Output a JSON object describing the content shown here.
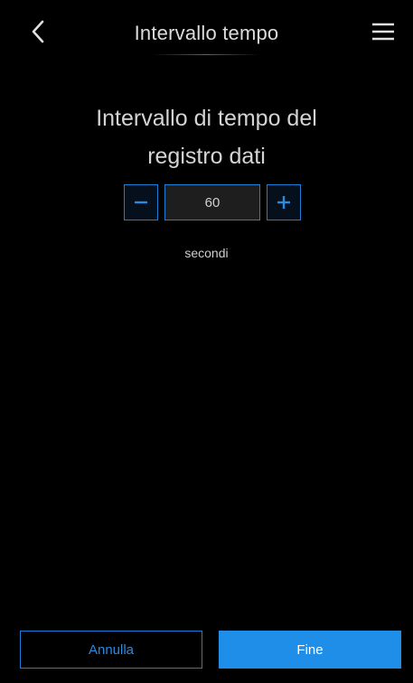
{
  "header": {
    "title": "Intervallo tempo",
    "back_icon": "chevron-left-icon",
    "menu_icon": "hamburger-menu-icon"
  },
  "main": {
    "heading_line1": "Intervallo di tempo del",
    "heading_line2": "registro dati",
    "stepper": {
      "value": "60",
      "decrement_icon": "minus-icon",
      "increment_icon": "plus-icon"
    },
    "unit": "secondi"
  },
  "footer": {
    "cancel_label": "Annulla",
    "done_label": "Fine"
  },
  "colors": {
    "background": "#000000",
    "accent": "#1f8ee8",
    "text": "#d4d4d4"
  }
}
